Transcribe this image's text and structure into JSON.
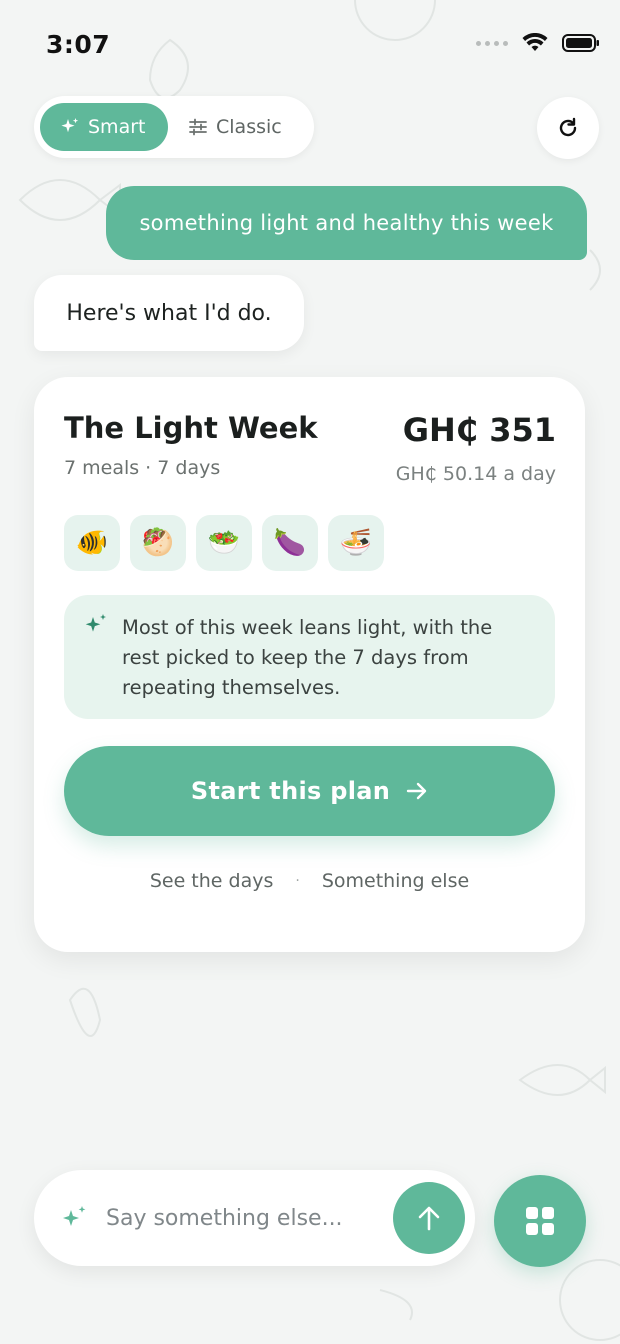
{
  "status": {
    "time": "3:07"
  },
  "mode_toggle": {
    "smart_label": "Smart",
    "classic_label": "Classic",
    "active": "Smart"
  },
  "chat": {
    "user_message": "something light and healthy this week",
    "bot_message": "Here's what I'd do."
  },
  "plan": {
    "title": "The Light Week",
    "meta": "7 meals · 7 days",
    "price": "GH₵ 351",
    "per_day": "GH₵ 50.14 a day",
    "meals": [
      {
        "emoji": "🐠",
        "icon": "fish-icon"
      },
      {
        "emoji": "🥙",
        "icon": "pita-icon"
      },
      {
        "emoji": "🥗",
        "icon": "salad-icon"
      },
      {
        "emoji": "🍆",
        "icon": "eggplant-icon"
      },
      {
        "emoji": "🍜",
        "icon": "soup-bowl-icon"
      }
    ],
    "note": "Most of this week leans light, with the rest picked to keep the 7 days from repeating themselves.",
    "start_label": "Start this plan",
    "see_days_label": "See the days",
    "separator": "·",
    "something_else_label": "Something else"
  },
  "composer": {
    "placeholder": "Say something else..."
  },
  "colors": {
    "accent": "#5fb89a",
    "note_bg": "#e7f4ee",
    "meal_tile_bg": "#e6f3ee"
  }
}
